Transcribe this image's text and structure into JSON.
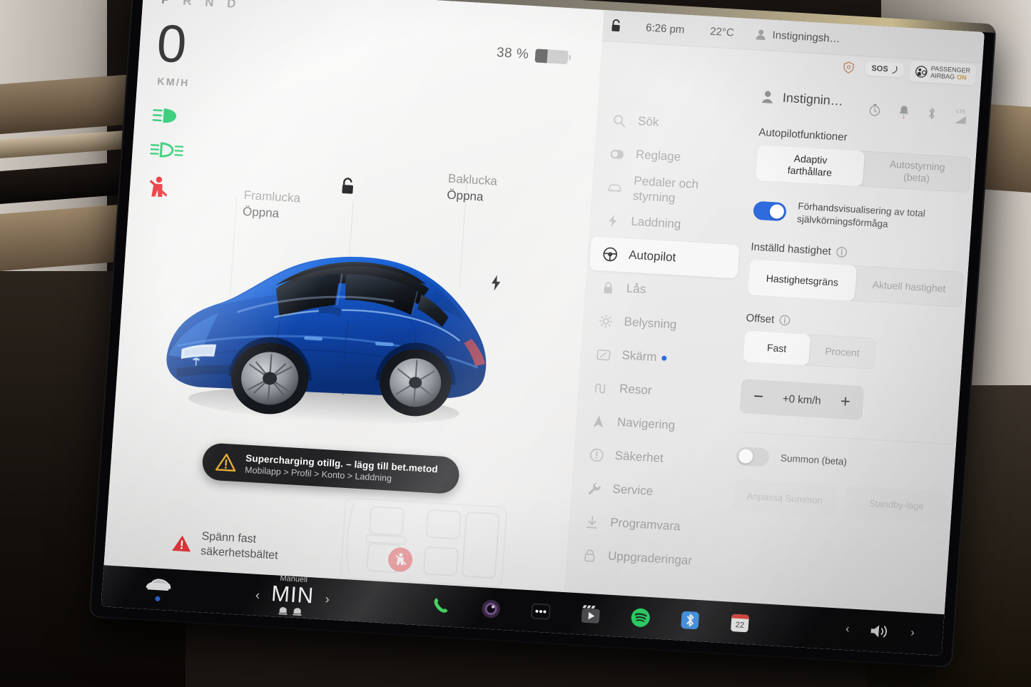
{
  "drive_panel": {
    "gear_indicator": "P R N D",
    "gear_active": "P",
    "speed": "0",
    "speed_unit": "KM/H",
    "battery_percent": "38 %",
    "battery_level": 38,
    "front_trunk": {
      "title": "Framlucka",
      "action": "Öppna"
    },
    "rear_trunk": {
      "title": "Baklucka",
      "action": "Öppna"
    },
    "warning_pill": {
      "line1": "Supercharging otillg. – lägg till bet.metod",
      "line2": "Mobilapp > Profil > Konto > Laddning"
    },
    "seatbelt_message": "Spänn fast\nsäkerhetsbältet",
    "tell_headlight": "headlight-low-beam-icon",
    "tell_foglight": "fog-light-icon",
    "tell_seatbelt": "seatbelt-warning-icon"
  },
  "status_bar": {
    "lock": "unlocked-icon",
    "time": "6:26 pm",
    "temperature": "22°C",
    "profile": "Instigningsh…",
    "sentry_label": "sentry-mode-icon",
    "sos_label": "SOS",
    "airbag_line1": "PASSENGER",
    "airbag_line2": "AIRBAG",
    "airbag_state": "ON"
  },
  "settings": {
    "profile_name": "Instignin…",
    "status_icons": [
      "timer-icon",
      "bell-icon",
      "bluetooth-icon",
      "lte-signal-icon"
    ],
    "lte_label": "LTE",
    "sidebar": [
      {
        "label": "Sök",
        "icon": "search-icon",
        "active": false
      },
      {
        "label": "Reglage",
        "icon": "toggle-icon",
        "active": false
      },
      {
        "label": "Pedaler och\nstyrning",
        "icon": "car-icon",
        "active": false
      },
      {
        "label": "Laddning",
        "icon": "bolt-icon",
        "active": false
      },
      {
        "label": "Autopilot",
        "icon": "steering-wheel-icon",
        "active": true
      },
      {
        "label": "Lås",
        "icon": "lock-icon",
        "active": false
      },
      {
        "label": "Belysning",
        "icon": "light-icon",
        "active": false
      },
      {
        "label": "Skärm",
        "icon": "display-icon",
        "active": false,
        "badge": true
      },
      {
        "label": "Resor",
        "icon": "trips-icon",
        "active": false
      },
      {
        "label": "Navigering",
        "icon": "navigation-icon",
        "active": false
      },
      {
        "label": "Säkerhet",
        "icon": "safety-icon",
        "active": false
      },
      {
        "label": "Service",
        "icon": "wrench-icon",
        "active": false
      },
      {
        "label": "Programvara",
        "icon": "download-icon",
        "active": false
      },
      {
        "label": "Uppgraderingar",
        "icon": "upgrade-icon",
        "active": false
      }
    ],
    "autopilot": {
      "section_title": "Autopilotfunktioner",
      "mode_options": [
        "Adaptiv\nfarthållare",
        "Autostyrning\n(beta)"
      ],
      "mode_selected": 0,
      "fsd_toggle_label": "Förhandsvisualisering av total\nsjälvkörningsförmåga",
      "fsd_toggle_on": true,
      "speed_title": "Inställd hastighet",
      "speed_options": [
        "Hastighetsgräns",
        "Aktuell hastighet"
      ],
      "speed_selected": 0,
      "offset_title": "Offset",
      "offset_options": [
        "Fast",
        "Procent"
      ],
      "offset_selected": 0,
      "offset_value": "+0 km/h",
      "offset_minus": "−",
      "offset_plus": "+",
      "summon_label": "Summon (beta)",
      "summon_on": false,
      "summon_buttons": [
        "Anpassa Summon",
        "Standby-läge"
      ]
    }
  },
  "dock": {
    "car_icon": "car-icon",
    "climate": {
      "mode": "Manuell",
      "temperature": "MIN",
      "prev": "‹",
      "next": "›",
      "seat_heaters": "seat-heater-icon"
    },
    "apps": [
      {
        "name": "phone-icon",
        "label": ""
      },
      {
        "name": "camera-icon",
        "label": ""
      },
      {
        "name": "more-apps-icon",
        "label": ""
      },
      {
        "name": "media-icon",
        "label": ""
      },
      {
        "name": "spotify-icon",
        "label": ""
      },
      {
        "name": "bluetooth-icon",
        "label": ""
      },
      {
        "name": "calendar-icon",
        "label": "22"
      }
    ],
    "volume_icon": "volume-icon",
    "prev_arrow": "‹",
    "next_arrow": "›"
  },
  "colors": {
    "accent_blue": "#2f6bdc",
    "warning_red": "#e8383d",
    "tell_green": "#3cd47e",
    "warning_amber": "#e8b23a",
    "spotify_green": "#1ed760",
    "bluetooth_blue": "#2d8ced"
  }
}
